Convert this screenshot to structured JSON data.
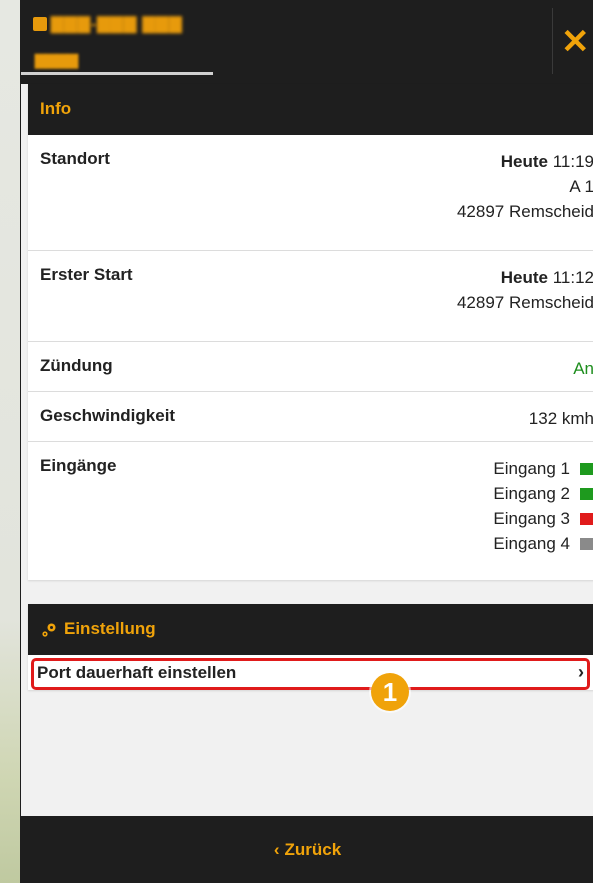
{
  "header": {
    "plate": "▇▇▇-▇▇▇ ▇▇▇",
    "plate_sub": "▇▇▇▇",
    "close_icon": "close-icon",
    "accent": "#f0a30a"
  },
  "info": {
    "title": "Info",
    "standort_label": "Standort",
    "standort_today": "Heute",
    "standort_time": "11:19",
    "standort_road": "A 1",
    "standort_city": "42897 Remscheid",
    "erster_label": "Erster Start",
    "erster_today": "Heute",
    "erster_time": "11:12",
    "erster_city": "42897 Remscheid",
    "zuendung_label": "Zündung",
    "zuendung_value": "An",
    "speed_label": "Geschwindigkeit",
    "speed_value": "132 kmh",
    "inputs_label": "Eingänge",
    "inputs": [
      {
        "name": "Eingang 1",
        "color": "#1e9a1e"
      },
      {
        "name": "Eingang 2",
        "color": "#1e9a1e"
      },
      {
        "name": "Eingang 3",
        "color": "#e01b1b"
      },
      {
        "name": "Eingang 4",
        "color": "#8a8a8a"
      }
    ]
  },
  "settings": {
    "title": "Einstellung",
    "port_label": "Port dauerhaft einstellen"
  },
  "annotation": {
    "badge": "1"
  },
  "footer": {
    "back_label": "Zurück"
  }
}
